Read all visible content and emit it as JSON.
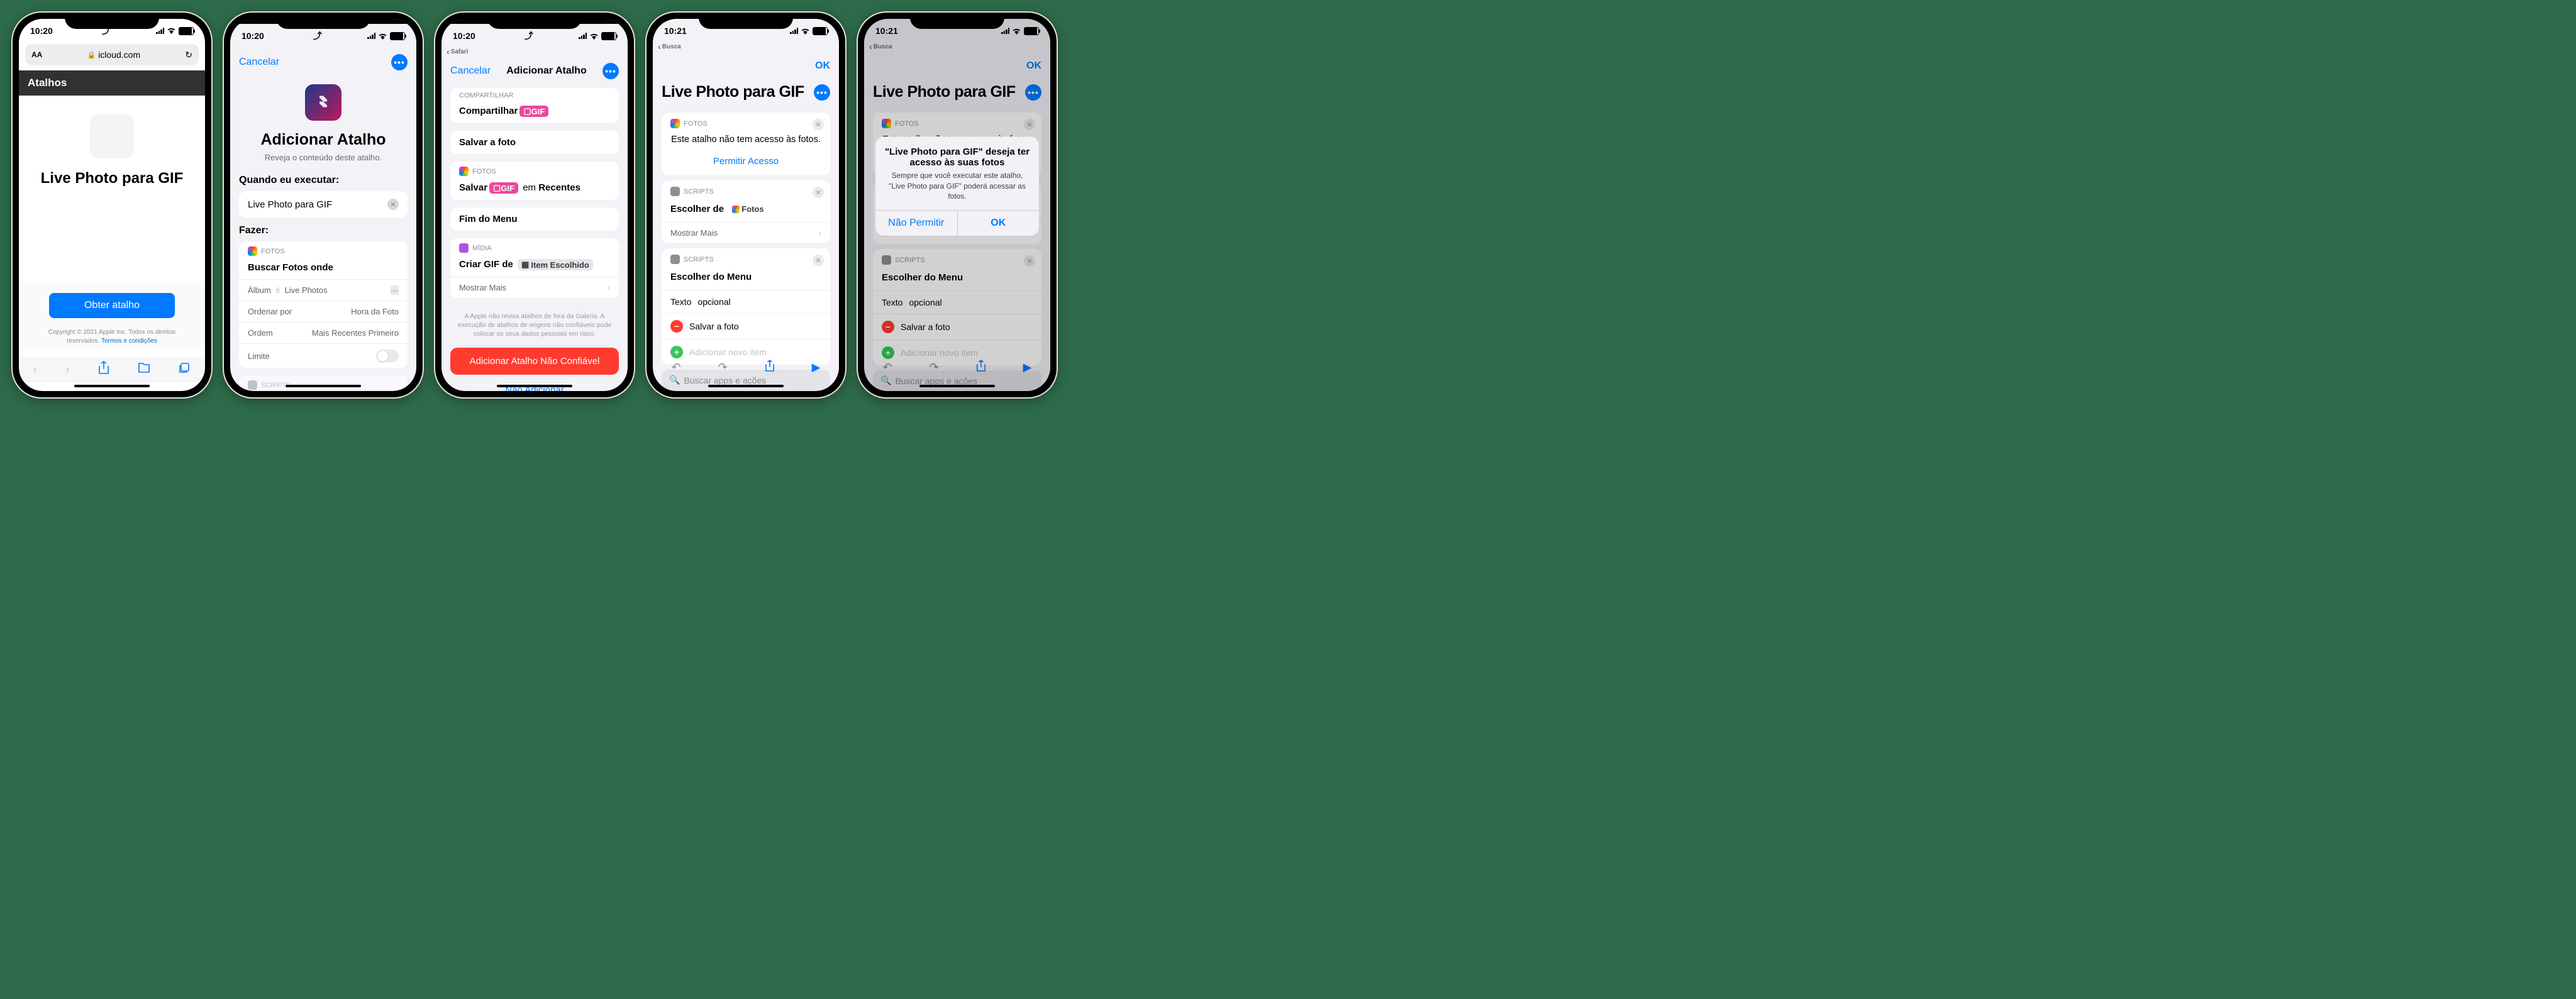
{
  "p1": {
    "time": "10:20",
    "url_label_aa": "AA",
    "url": "icloud.com",
    "header": "Atalhos",
    "title": "Live Photo para GIF",
    "button": "Obter atalho",
    "copyright": "Copyright © 2021 Apple Inc. Todos os direitos reservados.",
    "terms": "Termos e condições"
  },
  "p2": {
    "time": "10:20",
    "cancel": "Cancelar",
    "h1": "Adicionar Atalho",
    "sub": "Reveja o conteúdo deste atalho.",
    "sect1": "Quando eu executar:",
    "name": "Live Photo para GIF",
    "sect2": "Fazer:",
    "fotos_label": "FOTOS",
    "action": "Buscar  Fotos  onde",
    "f1k": "Álbum",
    "f1m": "é",
    "f1v": "Live Photos",
    "f2k": "Ordenar por",
    "f2v": "Hora da Foto",
    "f3k": "Ordem",
    "f3v": "Mais Recentes Primeiro",
    "f4k": "Limite",
    "scripts_label": "SCRIPTS"
  },
  "p3": {
    "time": "10:20",
    "back": "Safari",
    "cancel": "Cancelar",
    "title": "Adicionar Atalho",
    "share_hdr": "COMPARTILHAR",
    "share": "Compartilhar",
    "gif": "GIF",
    "save_title": "Salvar a foto",
    "fotos": "FOTOS",
    "save": "Salvar",
    "em": "em",
    "recents": "Recentes",
    "end": "Fim do Menu",
    "media": "MÍDIA",
    "create": "Criar GIF de",
    "item": "Item Escolhido",
    "more": "Mostrar Mais",
    "warn": "A Apple não revisa atalhos de fora da Galeria. A execução de atalhos de origens não confiáveis pode colocar os seus dados pessoais em risco.",
    "red": "Adicionar Atalho Não Confiável",
    "no": "Não Adicionar"
  },
  "p4": {
    "time": "10:21",
    "back": "Busca",
    "ok": "OK",
    "title": "Live Photo para GIF",
    "fotos": "FOTOS",
    "noaccess": "Este atalho não tem acesso às fotos.",
    "allow": "Permitir Acesso",
    "scripts": "SCRIPTS",
    "choose": "Escolher de",
    "photos_pill": "Fotos",
    "more": "Mostrar Mais",
    "menu": "Escolher do Menu",
    "text": "Texto",
    "optional": "opcional",
    "row1": "Salvar a foto",
    "row2": "Adicionar novo item",
    "search": "Buscar apps e ações"
  },
  "p5": {
    "time": "10:21",
    "back": "Busca",
    "ok": "OK",
    "title": "Live Photo para GIF",
    "fotos": "FOTOS",
    "noaccess": "Este atalho não tem acesso às fotos.",
    "scripts": "SCRIPTS",
    "menu": "Escolher do Menu",
    "text": "Texto",
    "optional": "opcional",
    "row1": "Salvar a foto",
    "row2": "Adicionar novo item",
    "search": "Buscar apps e ações",
    "alert_title": "\"Live Photo para GIF\" deseja ter acesso às suas fotos",
    "alert_msg": "Sempre que você executar este atalho, \"Live Photo para GIF\" poderá acessar as fotos.",
    "alert_no": "Não Permitir",
    "alert_ok": "OK"
  }
}
